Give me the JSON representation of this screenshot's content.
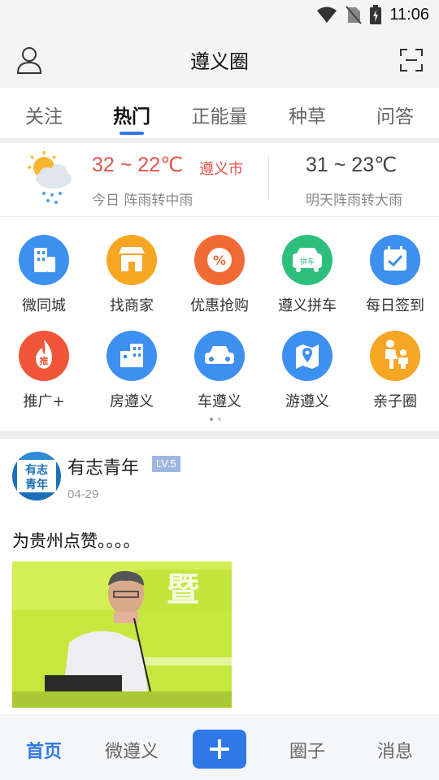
{
  "status_bar": {
    "time": "11:06"
  },
  "header": {
    "title": "遵义圈"
  },
  "tabs": [
    {
      "label": "关注"
    },
    {
      "label": "热门"
    },
    {
      "label": "正能量"
    },
    {
      "label": "种草"
    },
    {
      "label": "问答"
    }
  ],
  "active_tab": "热门",
  "weather": {
    "today_temp": "32 ~ 22℃",
    "city": "遵义市",
    "today_desc": "今日 阵雨转中雨",
    "tomorrow_temp": "31 ~ 23℃",
    "tomorrow_desc": "明天阵雨转大雨"
  },
  "grid": {
    "items": [
      {
        "label": "微同城",
        "icon": "building-icon",
        "color": "#3d8ff0"
      },
      {
        "label": "找商家",
        "icon": "shop-icon",
        "color": "#f5a623"
      },
      {
        "label": "优惠抢购",
        "icon": "discount-icon",
        "color": "#f06a35"
      },
      {
        "label": "遵义拼车",
        "icon": "carpool-icon",
        "color": "#2ebf7e",
        "badge": "拼车"
      },
      {
        "label": "每日签到",
        "icon": "calendar-check-icon",
        "color": "#3d8ff0"
      },
      {
        "label": "推广+",
        "icon": "promote-fire-icon",
        "color": "#f0553a",
        "badge": "推"
      },
      {
        "label": "房遵义",
        "icon": "house-icon",
        "color": "#3d8ff0"
      },
      {
        "label": "车遵义",
        "icon": "car-icon",
        "color": "#3d8ff0"
      },
      {
        "label": "游遵义",
        "icon": "map-pin-icon",
        "color": "#3d8ff0"
      },
      {
        "label": "亲子圈",
        "icon": "family-icon",
        "color": "#f5a623"
      }
    ]
  },
  "post": {
    "user_name": "有志青年",
    "level": "LV.5",
    "date": "04-29",
    "text": "为贵州点赞。。。。",
    "avatar_text": "有志青年"
  },
  "bottom_nav": {
    "home": "首页",
    "micro": "微遵义",
    "add_icon": "plus-icon",
    "circle": "圈子",
    "messages": "消息"
  },
  "colors": {
    "accent": "#2f79e6",
    "weather_red": "#e5534b"
  }
}
